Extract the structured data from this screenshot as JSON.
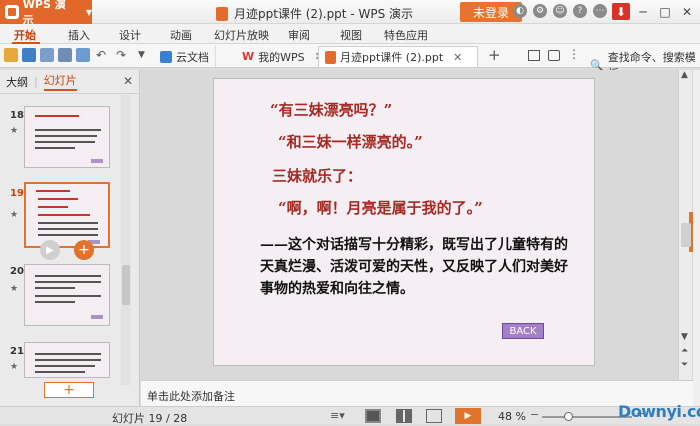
{
  "titlebar": {
    "app_button": "WPS 演示",
    "document_title": "月迹ppt课件 (2).ppt - WPS 演示",
    "login_button": "未登录"
  },
  "menu": {
    "items": [
      "开始",
      "插入",
      "设计",
      "动画",
      "幻灯片放映",
      "审阅",
      "视图",
      "特色应用"
    ],
    "active": "开始"
  },
  "tabs": [
    {
      "label": "云文档"
    },
    {
      "label": "我的WPS"
    },
    {
      "label": "月迹ppt课件 (2).ppt"
    }
  ],
  "command_search": "查找命令、搜索模板",
  "sidebar": {
    "tab_outline": "大纲",
    "tab_slides": "幻灯片",
    "thumbnails": [
      {
        "number": "18",
        "selected": false
      },
      {
        "number": "19",
        "selected": true
      },
      {
        "number": "20",
        "selected": false
      },
      {
        "number": "21",
        "selected": false
      }
    ]
  },
  "slide": {
    "lines": [
      "“有三妹漂亮吗？”",
      "“和三妹一样漂亮的。”",
      "三妹就乐了：",
      "“啊，啊！月亮是属于我的了。”"
    ],
    "body": "——这个对话描写十分精彩，既写出了儿童特有的天真烂漫、活泼可爱的天性，又反映了人们对美好事物的热爱和向往之情。",
    "back_button": "BACK"
  },
  "notes_placeholder": "单击此处添加备注",
  "status": {
    "slide_info": "幻灯片 19 / 28",
    "zoom": "48 %",
    "zoom_level_percent": 48
  },
  "watermark": "Downyi.com",
  "colors": {
    "accent": "#e0742d",
    "slide_red_text": "#a52a24",
    "slide_background": "#f5eef3"
  }
}
